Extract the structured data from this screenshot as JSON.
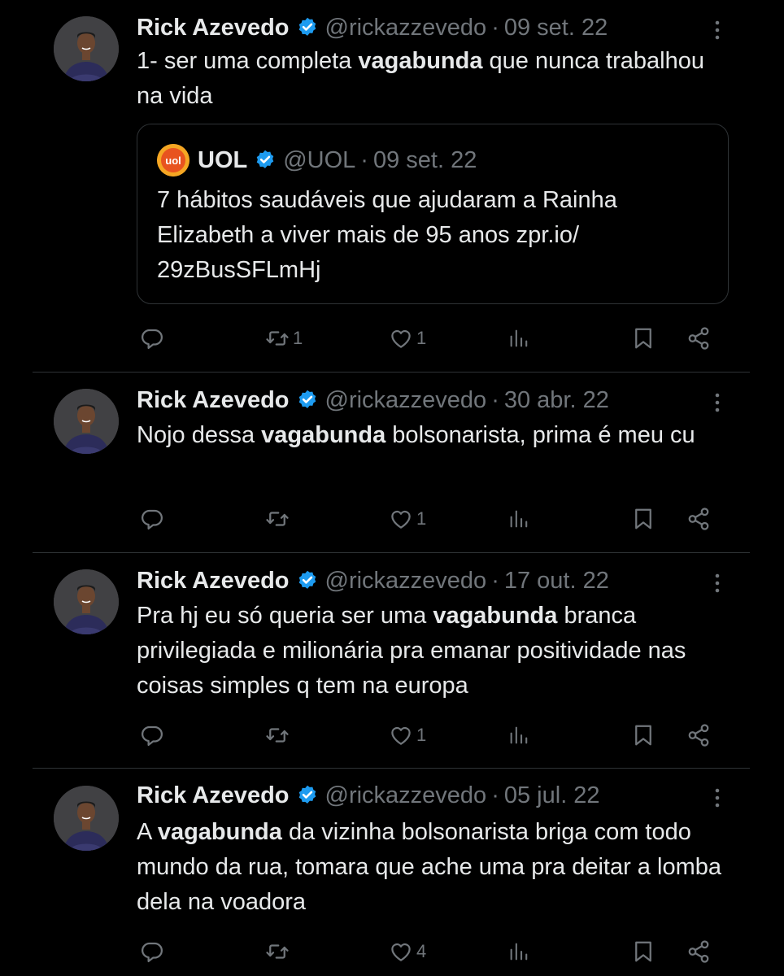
{
  "tweets": [
    {
      "name": "Rick Azevedo",
      "handle": "@rickazzevedo",
      "date": "09 set. 22",
      "text_before": "1- ser uma completa ",
      "text_bold": "vagabunda",
      "text_after": " que nunca trabalhou na vida",
      "quote": {
        "name": "UOL",
        "handle": "@UOL",
        "date": "09 set. 22",
        "logo_text": "uol",
        "text": "7 hábitos saudáveis que ajudaram a Rainha Elizabeth a viver mais de 95 anos zpr.io/ 29zBusSFLmHj"
      },
      "retweets": "1",
      "likes": "1"
    },
    {
      "name": "Rick Azevedo",
      "handle": "@rickazzevedo",
      "date": "30 abr. 22",
      "text_before": "Nojo dessa ",
      "text_bold": "vagabunda",
      "text_after": " bolsonarista, prima é meu cu",
      "retweets": "",
      "likes": "1"
    },
    {
      "name": "Rick Azevedo",
      "handle": "@rickazzevedo",
      "date": "17 out. 22",
      "text_before": "Pra hj eu só queria ser uma ",
      "text_bold": "vagabunda",
      "text_after": " branca privilegiada e milionária pra emanar positividade nas coisas simples q tem na europa",
      "retweets": "",
      "likes": "1"
    },
    {
      "name": "Rick Azevedo",
      "handle": "@rickazzevedo",
      "date": "05 jul. 22",
      "text_before": "A ",
      "text_bold": "vagabunda",
      "text_after": " da vizinha bolsonarista briga com todo mundo da rua, tomara que ache uma pra deitar a lomba dela na voadora",
      "retweets": "",
      "likes": "4"
    }
  ],
  "icons": {
    "verified": "verified-badge-icon",
    "more": "more-options-icon",
    "reply": "reply-icon",
    "retweet": "retweet-icon",
    "like": "like-icon",
    "views": "views-icon",
    "bookmark": "bookmark-icon",
    "share": "share-icon"
  },
  "colors": {
    "background": "#000000",
    "text": "#e7e9ea",
    "secondary": "#71767b",
    "verified": "#1d9bf0",
    "divider": "#2f3336",
    "uol_logo": "#f5a623"
  }
}
